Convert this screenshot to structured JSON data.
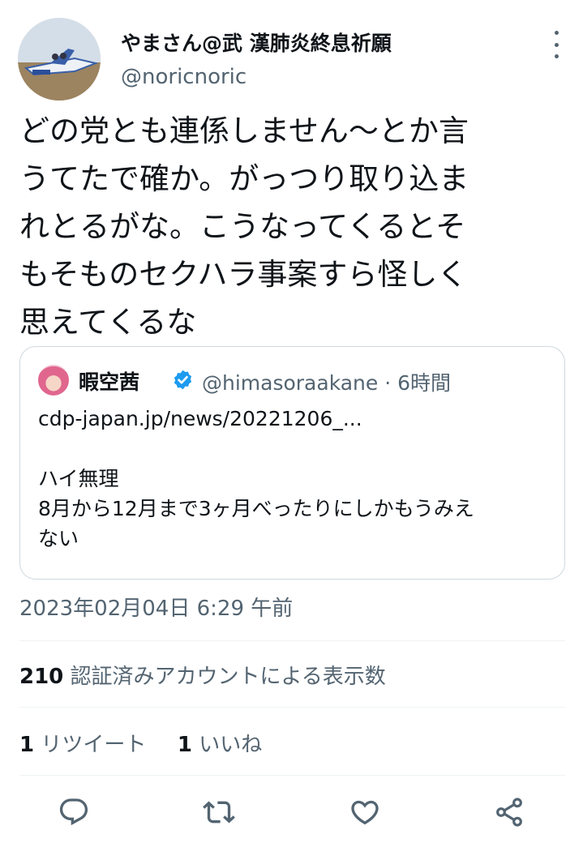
{
  "tweet": {
    "author": {
      "display_name": "やまさん@武 漢肺炎終息祈願",
      "handle": "@noricnoric",
      "avatar_icon": "jet-plane-photo-avatar"
    },
    "text": "どの党とも連係しません〜とか言\nうてたで確か。がっつり取り込ま\nれとるがな。こうなってくるとそ\nもそものセクハラ事案すら怪しく\n思えてくるな",
    "timestamp": "2023年02月04日 6:29 午前"
  },
  "quoted_tweet": {
    "author_name": "暇空茜",
    "verified": true,
    "handle_time": "@himasoraakane · 6時間",
    "body": "cdp-japan.jp/news/20221206_...\n\nハイ無理\n8月から12月まで3ヶ月べったりにしかもうみえ\nない"
  },
  "stats": {
    "views_count": "210",
    "views_label": "認証済みアカウントによる表示数",
    "retweets_count": "1",
    "retweets_label": "リツイート",
    "likes_count": "1",
    "likes_label": "いいね"
  },
  "actions": [
    {
      "icon": "reply-icon"
    },
    {
      "icon": "retweet-icon"
    },
    {
      "icon": "like-heart-icon"
    },
    {
      "icon": "share-icon"
    }
  ],
  "colors": {
    "text_primary": "#0f1419",
    "text_secondary": "#536471",
    "verified_blue": "#1d9bf0",
    "border": "#cfd9de"
  }
}
